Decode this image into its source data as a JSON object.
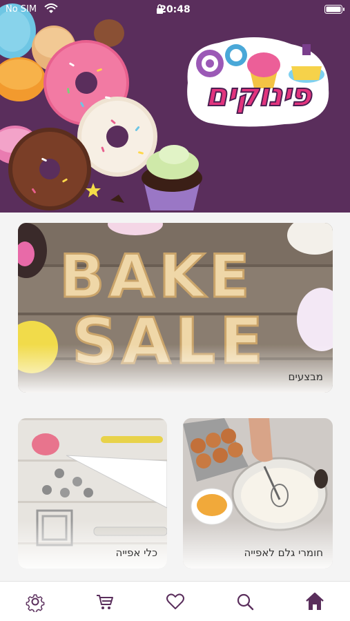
{
  "status_bar": {
    "carrier": "No SIM",
    "time": "20:48"
  },
  "hero": {
    "logo_text": "פינוקים"
  },
  "cards": [
    {
      "label": "מבצעים"
    },
    {
      "label": "כלי אפייה"
    },
    {
      "label": "חומרי גלם לאפייה"
    }
  ],
  "tab_bar": {
    "items": [
      "settings-icon",
      "cart-icon",
      "heart-icon",
      "search-icon",
      "home-icon"
    ],
    "active": "home-icon",
    "active_color": "#5a2e5c",
    "inactive_color": "#5a2e5c"
  }
}
